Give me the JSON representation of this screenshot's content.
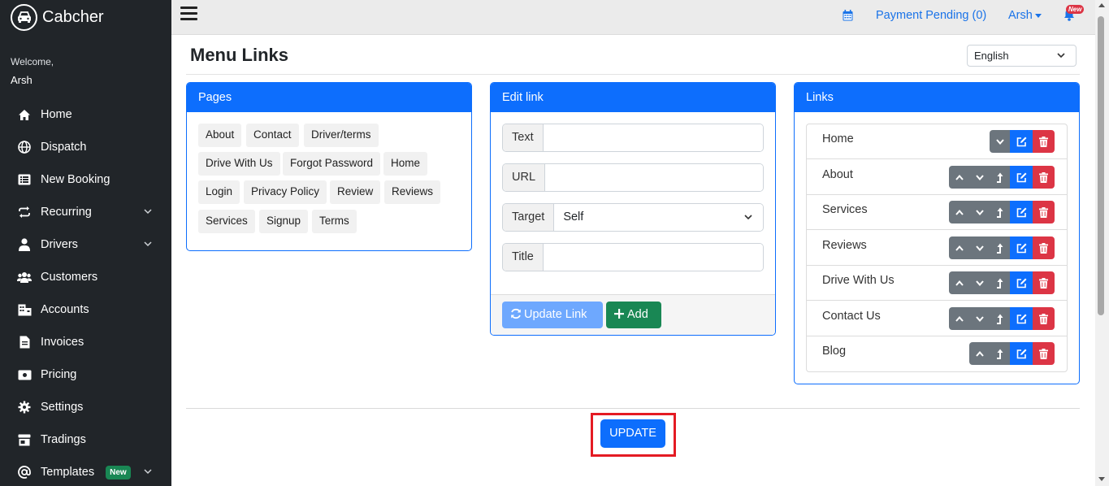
{
  "app": {
    "name": "Cabcher"
  },
  "user": {
    "welcome": "Welcome,",
    "name": "Arsh"
  },
  "sidebar": {
    "items": [
      {
        "label": "Home",
        "icon": "home-icon"
      },
      {
        "label": "Dispatch",
        "icon": "globe-icon"
      },
      {
        "label": "New Booking",
        "icon": "list-icon"
      },
      {
        "label": "Recurring",
        "icon": "repeat-icon",
        "expandable": true
      },
      {
        "label": "Drivers",
        "icon": "user-icon",
        "expandable": true
      },
      {
        "label": "Customers",
        "icon": "users-icon"
      },
      {
        "label": "Accounts",
        "icon": "building-icon"
      },
      {
        "label": "Invoices",
        "icon": "file-icon"
      },
      {
        "label": "Pricing",
        "icon": "money-icon"
      },
      {
        "label": "Settings",
        "icon": "gear-icon"
      },
      {
        "label": "Tradings",
        "icon": "store-icon"
      },
      {
        "label": "Templates",
        "icon": "at-icon",
        "badge": "New",
        "expandable": true
      }
    ]
  },
  "topbar": {
    "payment_pending": "Payment Pending (0)",
    "user": "Arsh",
    "bell_badge": "New"
  },
  "page": {
    "title": "Menu Links",
    "language": "English"
  },
  "pages_card": {
    "title": "Pages",
    "tags": [
      "About",
      "Contact",
      "Driver/terms",
      "Drive With Us",
      "Forgot Password",
      "Home",
      "Login",
      "Privacy Policy",
      "Review",
      "Reviews",
      "Services",
      "Signup",
      "Terms"
    ]
  },
  "edit_card": {
    "title": "Edit link",
    "fields": {
      "text_label": "Text",
      "text_value": "",
      "url_label": "URL",
      "url_value": "",
      "target_label": "Target",
      "target_value": "Self",
      "title_label": "Title",
      "title_value": ""
    },
    "update_link_label": "Update Link",
    "add_label": "Add"
  },
  "links_card": {
    "title": "Links",
    "items": [
      "Home",
      "About",
      "Services",
      "Reviews",
      "Drive With Us",
      "Contact Us",
      "Blog"
    ]
  },
  "update_button": "UPDATE",
  "colors": {
    "primary": "#0d6efd",
    "success": "#198754",
    "danger": "#dc3545",
    "secondary": "#6c757d",
    "sidebar": "#212529"
  }
}
